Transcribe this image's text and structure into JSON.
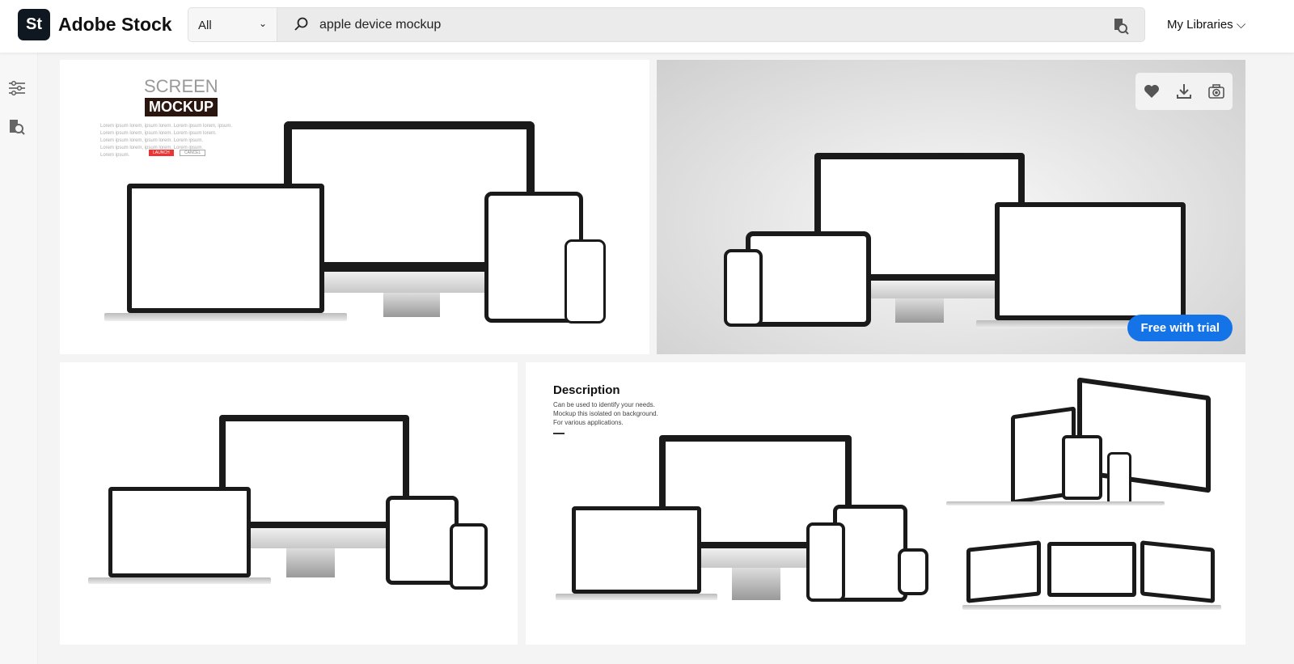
{
  "header": {
    "logo_text": "St",
    "brand": "Adobe Stock",
    "scope": "All",
    "query": "apple device mockup",
    "my_libraries": "My Libraries",
    "accent": "#1473e6"
  },
  "sidebar": {
    "items": [
      {
        "icon": "filters-icon"
      },
      {
        "icon": "visual-search-icon"
      }
    ]
  },
  "results": [
    {
      "kind": "screen-mockup",
      "title_line1": "SCREEN",
      "title_line2": "MOCKUP",
      "lorem": [
        "Lorem ipsum lorem, ipsum lorem. Lorem ipsum lorem, ipsum.",
        "Lorem ipsum lorem, ipsum lorem. Lorem ipsum lorem.",
        "Lorem ipsum lorem, ipsum lorem. Lorem ipsum.",
        "Lorem ipsum lorem, ipsum lorem. Lorem ipsum.",
        "Lorem ipsum."
      ],
      "btn1": "LAUNCH",
      "btn2": "CANCEL"
    },
    {
      "kind": "devices-transparent",
      "hovered": true,
      "actions": [
        "heart-icon",
        "download-icon",
        "camera-icon"
      ],
      "badge": "Free with trial"
    },
    {
      "kind": "devices-transparent"
    },
    {
      "kind": "description-mockup",
      "heading": "Description",
      "lines": [
        "Can be used to identify your needs.",
        "Mockup this isolated on background.",
        "For various applications."
      ]
    }
  ]
}
